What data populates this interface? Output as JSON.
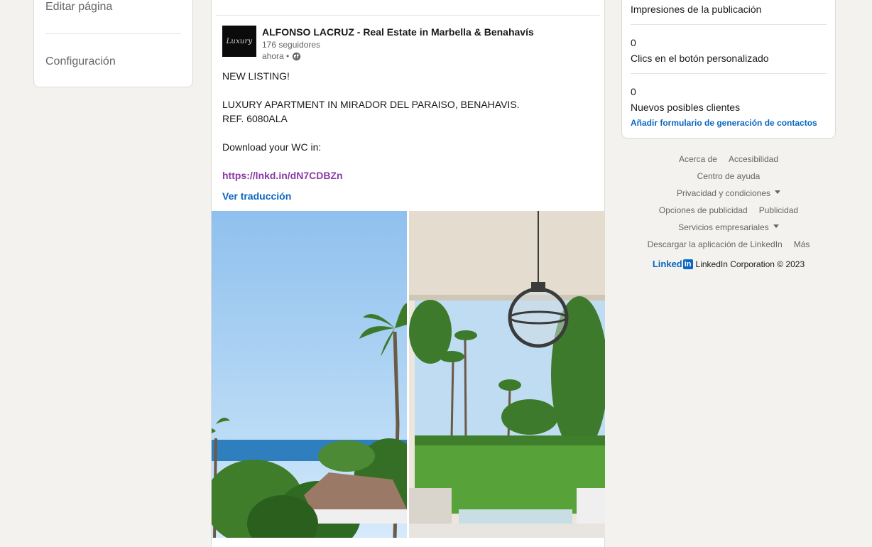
{
  "left_menu": {
    "edit_page": "Editar página",
    "settings": "Configuración"
  },
  "post": {
    "author_name": "ALFONSO LACRUZ - Real Estate in Marbella & Benahavís",
    "logo_text": "Luxury",
    "followers": "176 seguidores",
    "time": "ahora •",
    "visibility_icon": "globe-icon",
    "text_lines": [
      "NEW LISTING!",
      "",
      "LUXURY APARTMENT IN MIRADOR DEL PARAISO, BENAHAVIS.",
      "REF. 6080ALA",
      "",
      "Download your WC in:",
      ""
    ],
    "link": "https://lnkd.in/dN7CDBZn",
    "see_translation": "Ver traducción"
  },
  "analytics": {
    "impressions_label": "Impresiones de la publicación",
    "custom_button_clicks_value": "0",
    "custom_button_clicks_label": "Clics en el botón personalizado",
    "new_leads_value": "0",
    "new_leads_label": "Nuevos posibles clientes",
    "add_form_link": "Añadir formulario de generación de contactos"
  },
  "footer": {
    "about": "Acerca de",
    "accessibility": "Accesibilidad",
    "help_center": "Centro de ayuda",
    "privacy_terms": "Privacidad y condiciones",
    "ad_choices": "Opciones de publicidad",
    "advertising": "Publicidad",
    "business_services": "Servicios empresariales",
    "get_app": "Descargar la aplicación de LinkedIn",
    "more": "Más",
    "brand_word": "Linked",
    "brand_in": "in",
    "copyright": "LinkedIn Corporation © 2023"
  },
  "colors": {
    "background": "#f4f2ee",
    "link_blue": "#0a66c2",
    "visited_link": "#8b3aa8"
  }
}
